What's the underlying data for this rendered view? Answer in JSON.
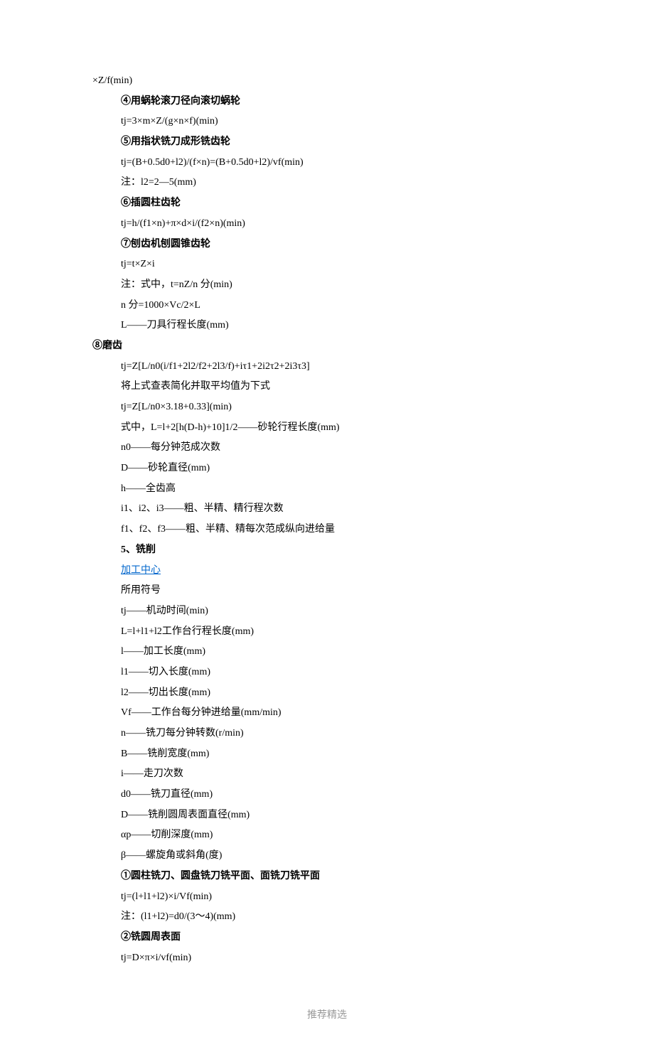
{
  "lines": [
    {
      "text": "×Z/f(min)",
      "indent": 0,
      "bold": false,
      "link": false
    },
    {
      "text": "④用蜗轮滚刀径向滚切蜗轮",
      "indent": 1,
      "bold": true,
      "link": false
    },
    {
      "text": "tj=3×m×Z/(g×n×f)(min)",
      "indent": 1,
      "bold": false,
      "link": false
    },
    {
      "text": "⑤用指状铣刀成形铣齿轮",
      "indent": 1,
      "bold": true,
      "link": false
    },
    {
      "text": "tj=(B+0.5d0+l2)/(f×n)=(B+0.5d0+l2)/vf(min)",
      "indent": 1,
      "bold": false,
      "link": false
    },
    {
      "text": "注：l2=2—5(mm)",
      "indent": 1,
      "bold": false,
      "link": false
    },
    {
      "text": "⑥插圆柱齿轮",
      "indent": 1,
      "bold": true,
      "link": false
    },
    {
      "text": "tj=h/(f1×n)+π×d×i/(f2×n)(min)",
      "indent": 1,
      "bold": false,
      "link": false
    },
    {
      "text": "⑦刨齿机刨圆锥齿轮",
      "indent": 1,
      "bold": true,
      "link": false
    },
    {
      "text": "tj=t×Z×i",
      "indent": 1,
      "bold": false,
      "link": false
    },
    {
      "text": "注：式中，t=nZ/n 分(min)",
      "indent": 1,
      "bold": false,
      "link": false
    },
    {
      "text": "n 分=1000×Vc/2×L",
      "indent": 1,
      "bold": false,
      "link": false
    },
    {
      "text": "L——刀具行程长度(mm)",
      "indent": 1,
      "bold": false,
      "link": false
    },
    {
      "text": "⑧磨齿",
      "indent": 0,
      "bold": true,
      "link": false
    },
    {
      "text": "tj=Z[L/n0(i/f1+2l2/f2+2l3/f)+iτ1+2i2τ2+2i3τ3]",
      "indent": 1,
      "bold": false,
      "link": false
    },
    {
      "text": "将上式查表简化并取平均值为下式",
      "indent": 1,
      "bold": false,
      "link": false
    },
    {
      "text": "tj=Z[L/n0×3.18+0.33](min)",
      "indent": 1,
      "bold": false,
      "link": false
    },
    {
      "text": "式中，L=l+2[h(D-h)+10]1/2——砂轮行程长度(mm)",
      "indent": 1,
      "bold": false,
      "link": false
    },
    {
      "text": "n0——每分钟范成次数",
      "indent": 1,
      "bold": false,
      "link": false
    },
    {
      "text": "D——砂轮直径(mm)",
      "indent": 1,
      "bold": false,
      "link": false
    },
    {
      "text": "h——全齿高",
      "indent": 1,
      "bold": false,
      "link": false
    },
    {
      "text": "i1、i2、i3——粗、半精、精行程次数",
      "indent": 1,
      "bold": false,
      "link": false
    },
    {
      "text": "f1、f2、f3——粗、半精、精每次范成纵向进给量",
      "indent": 1,
      "bold": false,
      "link": false
    },
    {
      "text": "5、铣削",
      "indent": 1,
      "bold": true,
      "link": false
    },
    {
      "text": "加工中心",
      "indent": 1,
      "bold": false,
      "link": true
    },
    {
      "text": "所用符号",
      "indent": 1,
      "bold": false,
      "link": false
    },
    {
      "text": "tj——机动时间(min)",
      "indent": 1,
      "bold": false,
      "link": false
    },
    {
      "text": "L=l+l1+l2工作台行程长度(mm)",
      "indent": 1,
      "bold": false,
      "link": false
    },
    {
      "text": "l——加工长度(mm)",
      "indent": 1,
      "bold": false,
      "link": false
    },
    {
      "text": "l1——切入长度(mm)",
      "indent": 1,
      "bold": false,
      "link": false
    },
    {
      "text": "l2——切出长度(mm)",
      "indent": 1,
      "bold": false,
      "link": false
    },
    {
      "text": "Vf——工作台每分钟进给量(mm/min)",
      "indent": 1,
      "bold": false,
      "link": false
    },
    {
      "text": "n——铣刀每分钟转数(r/min)",
      "indent": 1,
      "bold": false,
      "link": false
    },
    {
      "text": "B——铣削宽度(mm)",
      "indent": 1,
      "bold": false,
      "link": false
    },
    {
      "text": "i——走刀次数",
      "indent": 1,
      "bold": false,
      "link": false
    },
    {
      "text": "d0——铣刀直径(mm)",
      "indent": 1,
      "bold": false,
      "link": false
    },
    {
      "text": "D——铣削圆周表面直径(mm)",
      "indent": 1,
      "bold": false,
      "link": false
    },
    {
      "text": "αp——切削深度(mm)",
      "indent": 1,
      "bold": false,
      "link": false
    },
    {
      "text": "β——螺旋角或斜角(度)",
      "indent": 1,
      "bold": false,
      "link": false
    },
    {
      "text": "①圆柱铣刀、圆盘铣刀铣平面、面铣刀铣平面",
      "indent": 1,
      "bold": true,
      "link": false
    },
    {
      "text": "tj=(l+l1+l2)×i/Vf(min)",
      "indent": 1,
      "bold": false,
      "link": false
    },
    {
      "text": "注：(l1+l2)=d0/(3～4)(mm)",
      "indent": 1,
      "bold": false,
      "link": false
    },
    {
      "text": "②铣圆周表面",
      "indent": 1,
      "bold": true,
      "link": false
    },
    {
      "text": "tj=D×π×i/vf(min)",
      "indent": 1,
      "bold": false,
      "link": false
    }
  ],
  "footer": "推荐精选"
}
